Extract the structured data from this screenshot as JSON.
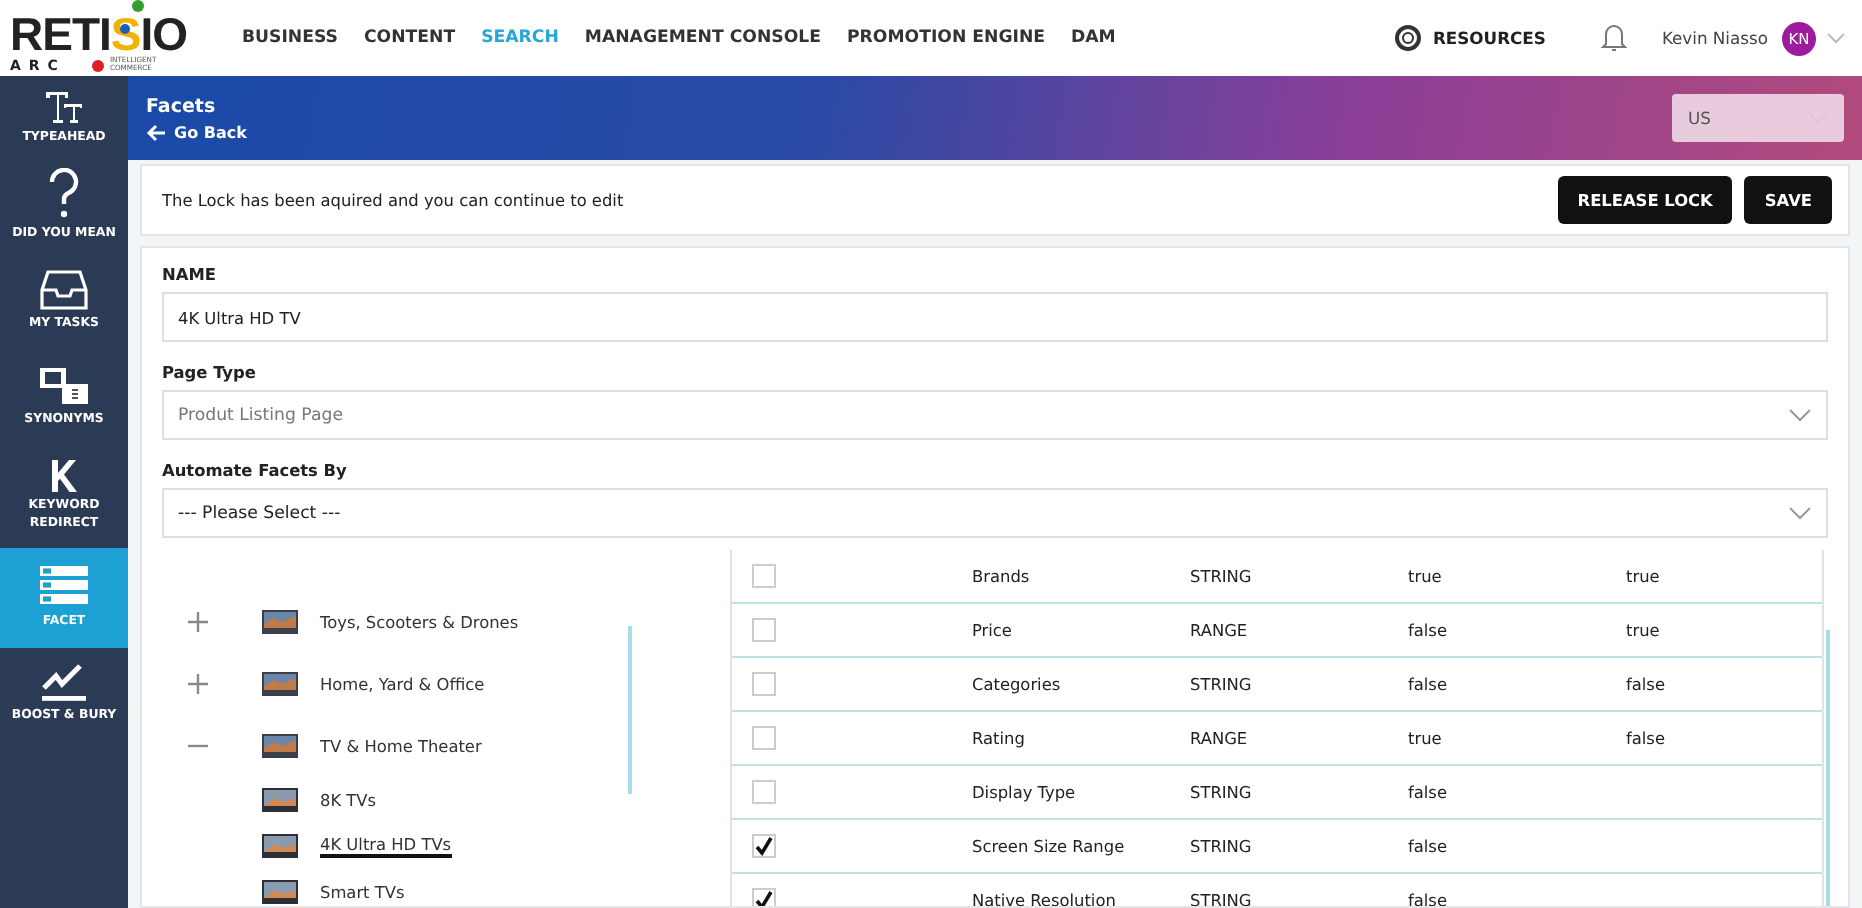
{
  "header": {
    "logo": {
      "word_start": "RETI",
      "word_highlight": "S",
      "word_end": "IO",
      "sub": "ARC",
      "tagline": "INTELLIGENT COMMERCE"
    },
    "nav": [
      {
        "label": "BUSINESS",
        "selected": false
      },
      {
        "label": "CONTENT",
        "selected": false
      },
      {
        "label": "SEARCH",
        "selected": true
      },
      {
        "label": "MANAGEMENT CONSOLE",
        "selected": false
      },
      {
        "label": "PROMOTION ENGINE",
        "selected": false
      },
      {
        "label": "DAM",
        "selected": false
      }
    ],
    "resources": "RESOURCES",
    "user_name": "Kevin Niasso",
    "user_initials": "KN"
  },
  "sidebar": {
    "items": [
      {
        "label": "TYPEAHEAD",
        "kind": "typeahead",
        "selected": false
      },
      {
        "label": "DID YOU MEAN",
        "kind": "question",
        "selected": false
      },
      {
        "label": "MY TASKS",
        "kind": "inbox",
        "selected": false
      },
      {
        "label": "SYNONYMS",
        "kind": "synonyms",
        "selected": false
      },
      {
        "label": "KEYWORD REDIRECT",
        "kind": "keyword",
        "selected": false
      },
      {
        "label": "FACET",
        "kind": "facet",
        "selected": true
      },
      {
        "label": "BOOST & BURY",
        "kind": "boost",
        "selected": false
      }
    ]
  },
  "banner": {
    "title": "Facets",
    "back": "Go Back",
    "locale": "US"
  },
  "lock_bar": {
    "message": "The Lock has been aquired and you can continue to edit",
    "buttons": [
      "RELEASE LOCK",
      "SAVE"
    ]
  },
  "form": {
    "name_label": "NAME",
    "name_value": "4K Ultra HD TV",
    "page_type_label": "Page Type",
    "page_type_value": "Produt Listing Page",
    "automate_label": "Automate Facets By",
    "automate_value": "--- Please Select ---"
  },
  "category_tree": [
    {
      "label": "Toys, Scooters & Drones",
      "expanded": false,
      "selected": false
    },
    {
      "label": "Home, Yard & Office",
      "expanded": false,
      "selected": false
    },
    {
      "label": "TV & Home Theater",
      "expanded": true,
      "selected": false,
      "children": [
        {
          "label": "8K TVs",
          "selected": false
        },
        {
          "label": "4K Ultra HD TVs",
          "selected": true
        },
        {
          "label": "Smart TVs",
          "selected": false
        }
      ]
    }
  ],
  "facet_table": {
    "rows": [
      {
        "checked": false,
        "name": "Brands",
        "type": "STRING",
        "column_4": "true",
        "column_5": "true"
      },
      {
        "checked": false,
        "name": "Price",
        "type": "RANGE",
        "column_4": "false",
        "column_5": "true"
      },
      {
        "checked": false,
        "name": "Categories",
        "type": "STRING",
        "column_4": "false",
        "column_5": "false"
      },
      {
        "checked": false,
        "name": "Rating",
        "type": "RANGE",
        "column_4": "true",
        "column_5": "false"
      },
      {
        "checked": false,
        "name": "Display Type",
        "type": "STRING",
        "column_4": "false"
      },
      {
        "checked": true,
        "name": "Screen Size Range",
        "type": "STRING",
        "column_4": "false"
      },
      {
        "checked": true,
        "name": "Native Resolution",
        "type": "STRING",
        "column_4": "false"
      }
    ]
  }
}
